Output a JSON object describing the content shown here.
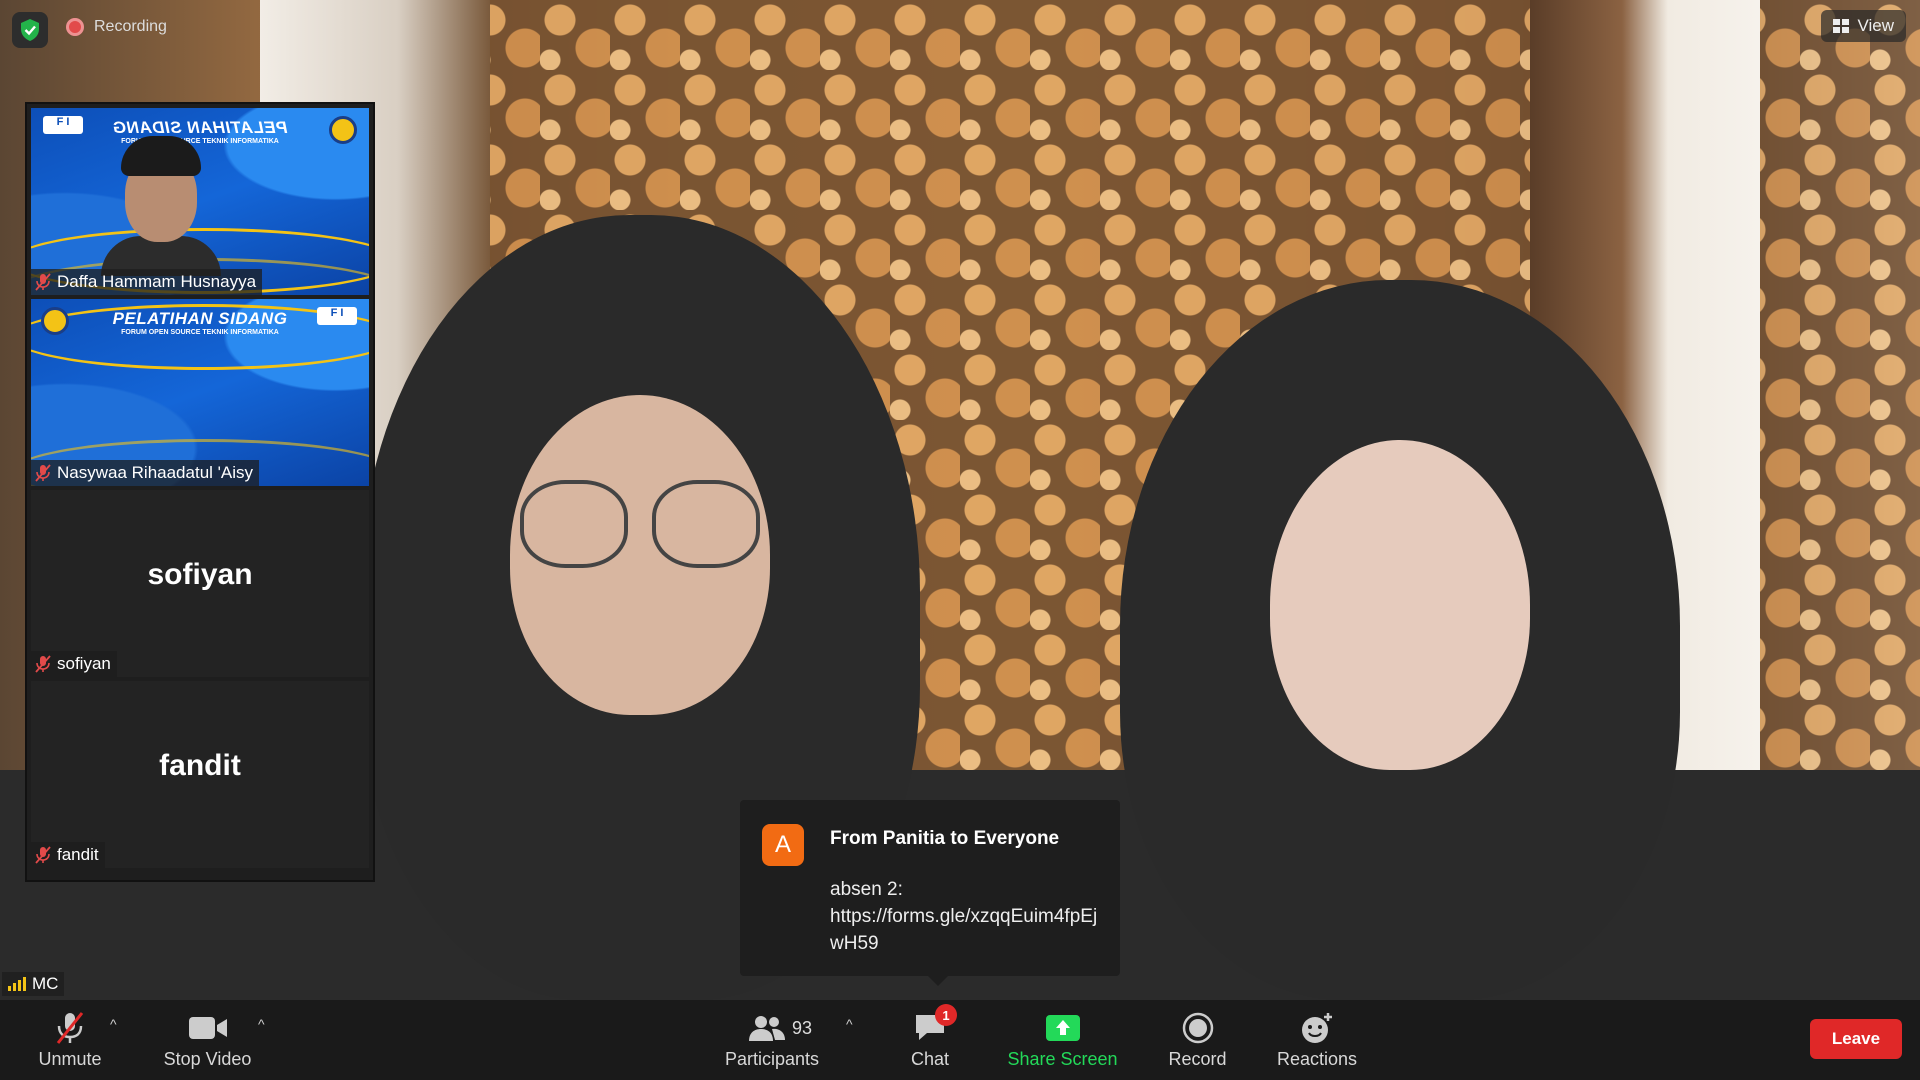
{
  "top": {
    "recording_label": "Recording",
    "view_label": "View",
    "security_icon": "shield-check-icon"
  },
  "gallery": {
    "tiles": [
      {
        "name": "Daffa Hammam Husnayya",
        "banner_title": "PELATIHAN SIDANG",
        "banner_sub": "FORUM OPEN SOURCE TEKNIK INFORMATIKA",
        "banner_logo": "F I",
        "type": "video"
      },
      {
        "name": "Nasywaa Rihaadatul 'Aisy",
        "banner_title": "PELATIHAN SIDANG",
        "banner_sub": "FORUM OPEN SOURCE TEKNIK INFORMATIKA",
        "banner_logo": "F I",
        "type": "banner"
      },
      {
        "name": "sofiyan",
        "display_name": "sofiyan",
        "type": "name-only"
      },
      {
        "name": "fandit",
        "display_name": "fandit",
        "type": "name-only"
      }
    ]
  },
  "speaker": {
    "label": "MC"
  },
  "chat_toast": {
    "avatar_letter": "A",
    "from": "From Panitia to Everyone",
    "message_line1": "absen 2:",
    "message_line2": "https://forms.gle/xzqqEuim4fpEjwH59"
  },
  "toolbar": {
    "unmute": "Unmute",
    "stop_video": "Stop Video",
    "participants": "Participants",
    "participants_count": "93",
    "chat": "Chat",
    "chat_badge": "1",
    "share_screen": "Share Screen",
    "record": "Record",
    "reactions": "Reactions",
    "leave": "Leave",
    "accent_green": "#23d959",
    "leave_red": "#e02828"
  }
}
